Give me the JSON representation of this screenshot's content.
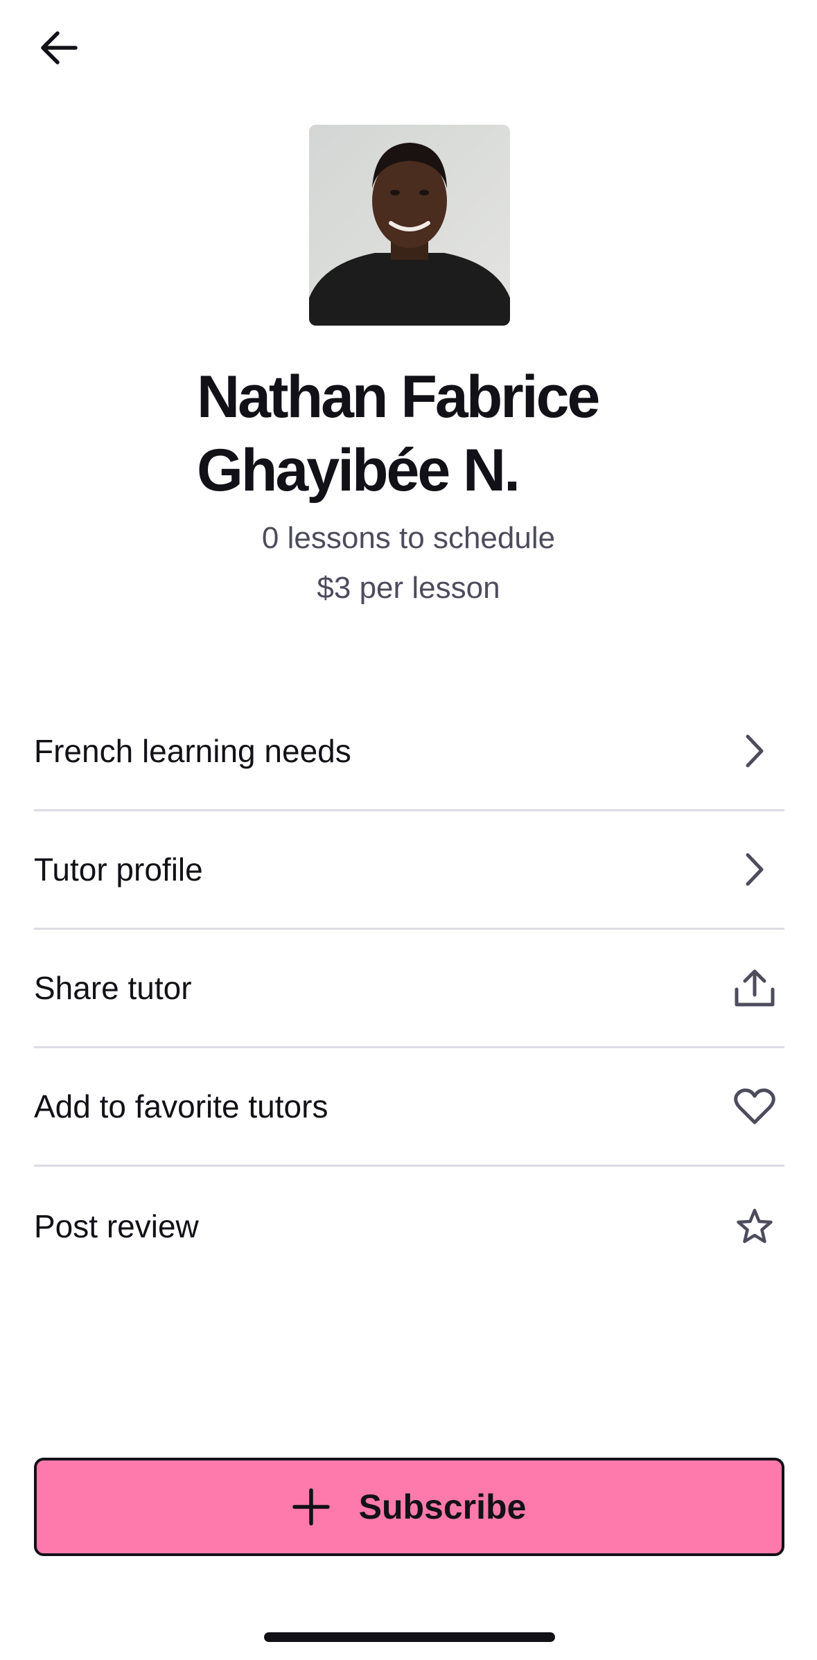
{
  "header": {
    "back_icon": "arrow-left-icon"
  },
  "tutor": {
    "photo_icon": "tutor-photo",
    "name": "Nathan Fabrice Ghayibée N.",
    "lessons_to_schedule": "0 lessons to schedule",
    "price_per_lesson": "$3 per lesson"
  },
  "menu": {
    "items": [
      {
        "label": "French learning needs",
        "icon": "chevron-right-icon"
      },
      {
        "label": "Tutor profile",
        "icon": "chevron-right-icon"
      },
      {
        "label": "Share tutor",
        "icon": "share-icon"
      },
      {
        "label": "Add to favorite tutors",
        "icon": "heart-icon"
      },
      {
        "label": "Post review",
        "icon": "star-icon"
      }
    ]
  },
  "subscribe": {
    "label": "Subscribe",
    "icon": "plus-icon",
    "color": "#ff7aac"
  }
}
